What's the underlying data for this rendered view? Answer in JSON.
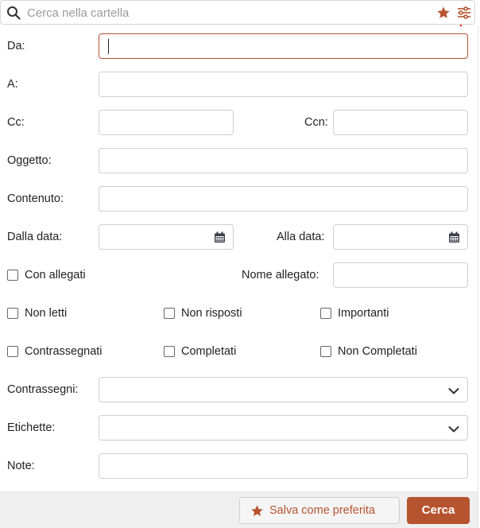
{
  "search": {
    "placeholder": "Cerca nella cartella",
    "value": ""
  },
  "icons": {
    "search": "search-icon",
    "favorite": "star-icon",
    "filters": "sliders-icon",
    "calendar": "calendar-icon",
    "dropdown": "chevron-down-icon"
  },
  "form": {
    "from_label": "Da:",
    "to_label": "A:",
    "cc_label": "Cc:",
    "bcc_label": "Ccn:",
    "subject_label": "Oggetto:",
    "content_label": "Contenuto:",
    "date_from_label": "Dalla data:",
    "date_to_label": "Alla data:",
    "attachments_label": "Con allegati",
    "attachment_name_label": "Nome allegato:",
    "unread_label": "Non letti",
    "unanswered_label": "Non risposti",
    "important_label": "Importanti",
    "flagged_label": "Contrassegnati",
    "completed_label": "Completati",
    "not_completed_label": "Non Completati",
    "flags_label": "Contrassegni:",
    "tags_label": "Etichette:",
    "notes_label": "Note:"
  },
  "footer": {
    "save_favorite_label": "Salva come preferita",
    "search_label": "Cerca"
  },
  "colors": {
    "accent": "#b6542f",
    "annotation_arrow": "#e00000"
  }
}
